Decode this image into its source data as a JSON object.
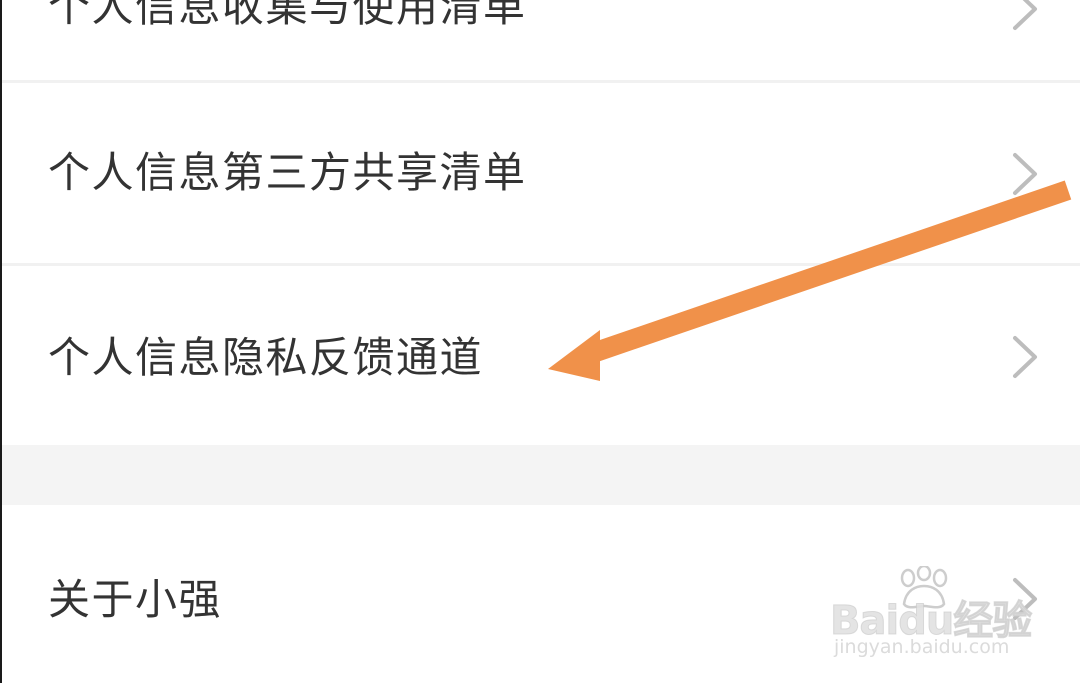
{
  "menu": {
    "items": [
      {
        "label": "个人信息收集与使用清单"
      },
      {
        "label": "个人信息第三方共享清单"
      },
      {
        "label": "个人信息隐私反馈通道"
      },
      {
        "label": "关于小强"
      }
    ]
  },
  "annotation": {
    "arrow_color": "#f0914a",
    "points_to": "个人信息隐私反馈通道"
  },
  "watermark": {
    "brand": "Baidu经验",
    "url": "jingyan.baidu.com"
  },
  "icons": {
    "chevron": "chevron-right-icon",
    "paw": "baidu-paw-icon"
  }
}
